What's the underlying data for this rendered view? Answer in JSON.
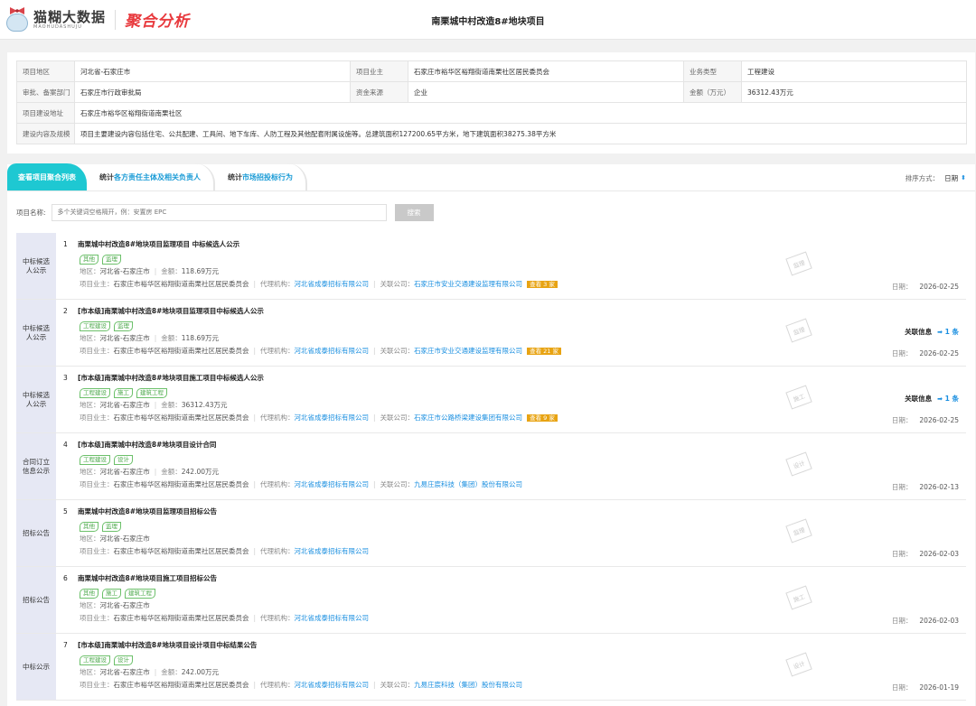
{
  "header": {
    "logo_cn": "猫糊大数据",
    "logo_en": "MAOHUDASHUJU",
    "brand": "聚合分析",
    "title": "南栗城中村改造8#地块项目"
  },
  "info": {
    "region_k": "项目地区",
    "region_v": "河北省-石家庄市",
    "owner_k": "项目业主",
    "owner_v": "石家庄市裕华区裕翔街道南栗社区居民委员会",
    "biz_k": "业务类型",
    "biz_v": "工程建设",
    "dept_k": "审批、备案部门",
    "dept_v": "石家庄市行政审批局",
    "fund_k": "资金来源",
    "fund_v": "企业",
    "amount_k": "金额（万元）",
    "amount_v": "36312.43万元",
    "addr_k": "项目建设地址",
    "addr_v": "石家庄市裕华区裕翔街道南栗社区",
    "scope_k": "建设内容及规模",
    "scope_v": "项目主要建设内容包括住宅、公共配建、工具间、地下车库、人防工程及其他配套附属设施等。总建筑面积127200.65平方米，地下建筑面积38275.38平方米"
  },
  "tabs": [
    {
      "pre": "查看",
      "hl": "项目聚合列表"
    },
    {
      "pre": "统计",
      "hl": "各方责任主体及相关负责人"
    },
    {
      "pre": "统计",
      "hl": "市场招投标行为"
    }
  ],
  "sort": {
    "label": "排序方式：",
    "value": "日期"
  },
  "search": {
    "label": "项目名称:",
    "placeholder": "多个关键词空格隔开，例：安置房 EPC",
    "button": "搜索"
  },
  "labels": {
    "area": "地区：",
    "money": "金额：",
    "owner": "项目业主：",
    "agent": "代理机构：",
    "company": "关联公司：",
    "date": "日期：",
    "rel": "关联信息",
    "rel_unit": "条"
  },
  "rows": [
    {
      "type": "中标候选人公示",
      "no": "1",
      "title": "南栗城中村改造8#地块项目监理项目 中标候选人公示",
      "tags": [
        "其他",
        "监理"
      ],
      "area": "河北省-石家庄市",
      "money": "118.69万元",
      "owner": "石家庄市裕华区裕翔街道南栗社区居民委员会",
      "agent": "河北省成泰招标有限公司",
      "company": "石家庄市安业交通建设监理有限公司",
      "badge": "查看 3 家",
      "stamp": "监理",
      "date": "2026-02-25",
      "rel": ""
    },
    {
      "type": "中标候选人公示",
      "no": "2",
      "title": "[市本级]南栗城中村改造8#地块项目监理项目中标候选人公示",
      "tags": [
        "工程建设",
        "监理"
      ],
      "area": "河北省-石家庄市",
      "money": "118.69万元",
      "owner": "石家庄市裕华区裕翔街道南栗社区居民委员会",
      "agent": "河北省成泰招标有限公司",
      "company": "石家庄市安业交通建设监理有限公司",
      "badge": "查看 21 家",
      "stamp": "监理",
      "date": "2026-02-25",
      "rel": "1"
    },
    {
      "type": "中标候选人公示",
      "no": "3",
      "title": "[市本级]南栗城中村改造8#地块项目施工项目中标候选人公示",
      "tags": [
        "工程建设",
        "施工",
        "建筑工程"
      ],
      "area": "河北省-石家庄市",
      "money": "36312.43万元",
      "owner": "石家庄市裕华区裕翔街道南栗社区居民委员会",
      "agent": "河北省成泰招标有限公司",
      "company": "石家庄市公路桥梁建设集团有限公司",
      "badge": "查看 9 家",
      "stamp": "施工",
      "date": "2026-02-25",
      "rel": "1"
    },
    {
      "type": "合同订立信息公示",
      "no": "4",
      "title": "[市本级]南栗城中村改造8#地块项目设计合同",
      "tags": [
        "工程建设",
        "设计"
      ],
      "area": "河北省-石家庄市",
      "money": "242.00万元",
      "owner": "石家庄市裕华区裕翔街道南栗社区居民委员会",
      "agent": "河北省成泰招标有限公司",
      "company": "九易庄宸科技（集团）股份有限公司",
      "badge": "",
      "stamp": "设计",
      "date": "2026-02-13",
      "rel": ""
    },
    {
      "type": "招标公告",
      "no": "5",
      "title": "南栗城中村改造8#地块项目监理项目招标公告",
      "tags": [
        "其他",
        "监理"
      ],
      "area": "河北省-石家庄市",
      "money": "",
      "owner": "石家庄市裕华区裕翔街道南栗社区居民委员会",
      "agent": "河北省成泰招标有限公司",
      "company": "",
      "badge": "",
      "stamp": "监理",
      "date": "2026-02-03",
      "rel": ""
    },
    {
      "type": "招标公告",
      "no": "6",
      "title": "南栗城中村改造8#地块项目施工项目招标公告",
      "tags": [
        "其他",
        "施工",
        "建筑工程"
      ],
      "area": "河北省-石家庄市",
      "money": "",
      "owner": "石家庄市裕华区裕翔街道南栗社区居民委员会",
      "agent": "河北省成泰招标有限公司",
      "company": "",
      "badge": "",
      "stamp": "施工",
      "date": "2026-02-03",
      "rel": ""
    },
    {
      "type": "中标公示",
      "no": "7",
      "title": "[市本级]南栗城中村改造8#地块项目设计项目中标结果公告",
      "tags": [
        "工程建设",
        "设计"
      ],
      "area": "河北省-石家庄市",
      "money": "242.00万元",
      "owner": "石家庄市裕华区裕翔街道南栗社区居民委员会",
      "agent": "河北省成泰招标有限公司",
      "company": "九易庄宸科技（集团）股份有限公司",
      "badge": "",
      "stamp": "设计",
      "date": "2026-01-19",
      "rel": ""
    }
  ]
}
